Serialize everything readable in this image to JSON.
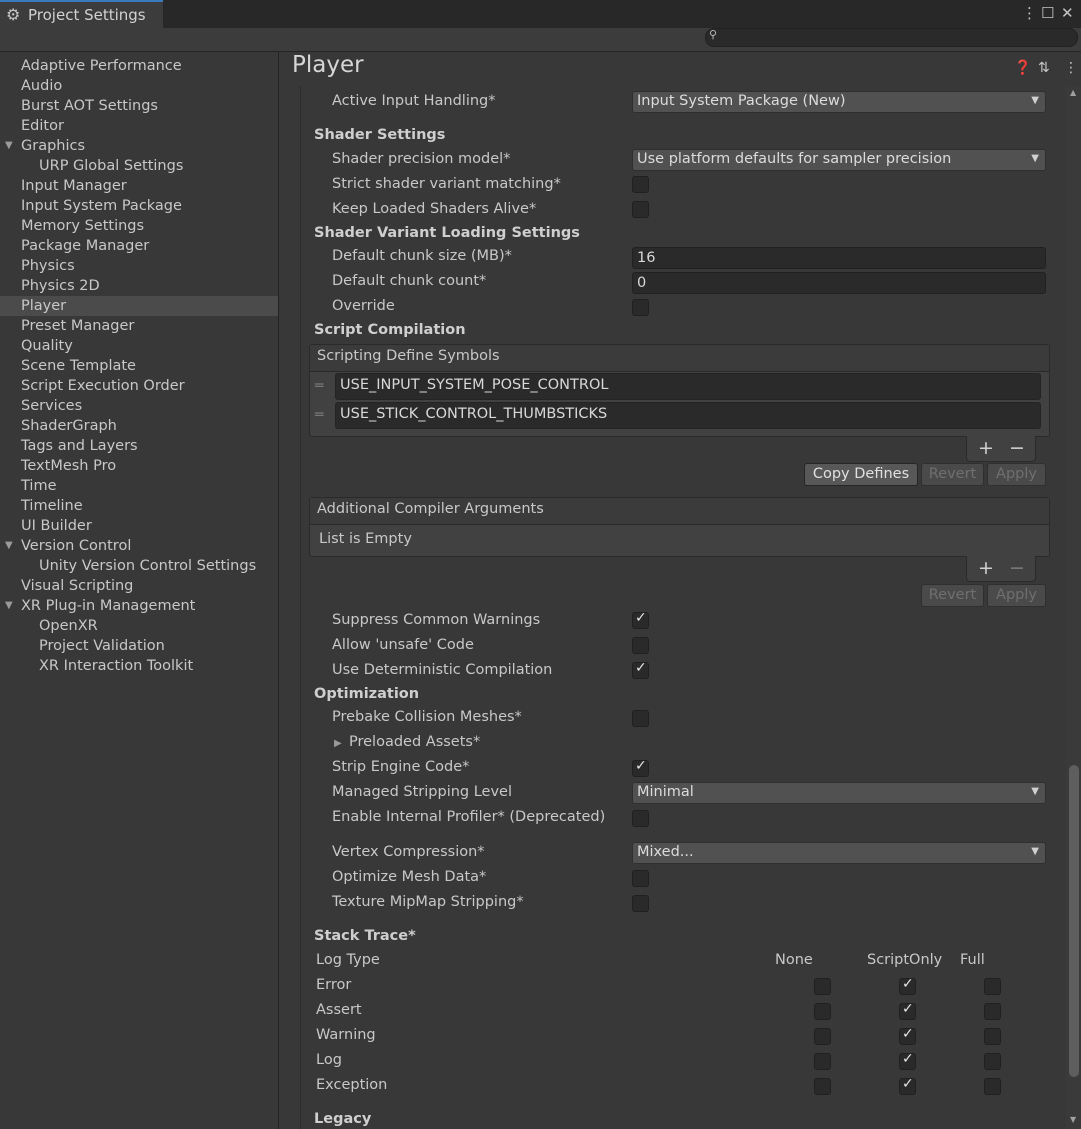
{
  "window": {
    "tab_title": "Project Settings",
    "search": {
      "placeholder": ""
    }
  },
  "sidebar": {
    "items": [
      {
        "label": "Adaptive Performance",
        "indent": 0,
        "foldout": "none",
        "selected": false
      },
      {
        "label": "Audio",
        "indent": 0,
        "foldout": "none",
        "selected": false
      },
      {
        "label": "Burst AOT Settings",
        "indent": 0,
        "foldout": "none",
        "selected": false
      },
      {
        "label": "Editor",
        "indent": 0,
        "foldout": "none",
        "selected": false
      },
      {
        "label": "Graphics",
        "indent": 0,
        "foldout": "open",
        "selected": false
      },
      {
        "label": "URP Global Settings",
        "indent": 1,
        "foldout": "none",
        "selected": false
      },
      {
        "label": "Input Manager",
        "indent": 0,
        "foldout": "none",
        "selected": false
      },
      {
        "label": "Input System Package",
        "indent": 0,
        "foldout": "none",
        "selected": false
      },
      {
        "label": "Memory Settings",
        "indent": 0,
        "foldout": "none",
        "selected": false
      },
      {
        "label": "Package Manager",
        "indent": 0,
        "foldout": "none",
        "selected": false
      },
      {
        "label": "Physics",
        "indent": 0,
        "foldout": "none",
        "selected": false
      },
      {
        "label": "Physics 2D",
        "indent": 0,
        "foldout": "none",
        "selected": false
      },
      {
        "label": "Player",
        "indent": 0,
        "foldout": "none",
        "selected": true
      },
      {
        "label": "Preset Manager",
        "indent": 0,
        "foldout": "none",
        "selected": false
      },
      {
        "label": "Quality",
        "indent": 0,
        "foldout": "none",
        "selected": false
      },
      {
        "label": "Scene Template",
        "indent": 0,
        "foldout": "none",
        "selected": false
      },
      {
        "label": "Script Execution Order",
        "indent": 0,
        "foldout": "none",
        "selected": false
      },
      {
        "label": "Services",
        "indent": 0,
        "foldout": "none",
        "selected": false
      },
      {
        "label": "ShaderGraph",
        "indent": 0,
        "foldout": "none",
        "selected": false
      },
      {
        "label": "Tags and Layers",
        "indent": 0,
        "foldout": "none",
        "selected": false
      },
      {
        "label": "TextMesh Pro",
        "indent": 0,
        "foldout": "none",
        "selected": false
      },
      {
        "label": "Time",
        "indent": 0,
        "foldout": "none",
        "selected": false
      },
      {
        "label": "Timeline",
        "indent": 0,
        "foldout": "none",
        "selected": false
      },
      {
        "label": "UI Builder",
        "indent": 0,
        "foldout": "none",
        "selected": false
      },
      {
        "label": "Version Control",
        "indent": 0,
        "foldout": "open",
        "selected": false
      },
      {
        "label": "Unity Version Control Settings",
        "indent": 1,
        "foldout": "none",
        "selected": false
      },
      {
        "label": "Visual Scripting",
        "indent": 0,
        "foldout": "none",
        "selected": false
      },
      {
        "label": "XR Plug-in Management",
        "indent": 0,
        "foldout": "open",
        "selected": false
      },
      {
        "label": "OpenXR",
        "indent": 1,
        "foldout": "none",
        "selected": false
      },
      {
        "label": "Project Validation",
        "indent": 1,
        "foldout": "none",
        "selected": false
      },
      {
        "label": "XR Interaction Toolkit",
        "indent": 1,
        "foldout": "none",
        "selected": false
      }
    ]
  },
  "main": {
    "title": "Player",
    "active_input_handling": {
      "label": "Active Input Handling*",
      "value": "Input System Package (New)"
    },
    "shader_settings": {
      "heading": "Shader Settings",
      "precision_model": {
        "label": "Shader precision model*",
        "value": "Use platform defaults for sampler precision"
      },
      "strict_variant": {
        "label": "Strict shader variant matching*",
        "checked": false
      },
      "keep_loaded": {
        "label": "Keep Loaded Shaders Alive*",
        "checked": false
      }
    },
    "variant_loading": {
      "heading": "Shader Variant Loading Settings",
      "chunk_size": {
        "label": "Default chunk size (MB)*",
        "value": "16"
      },
      "chunk_count": {
        "label": "Default chunk count*",
        "value": "0"
      },
      "override": {
        "label": "Override",
        "checked": false
      }
    },
    "script_compilation": {
      "heading": "Script Compilation",
      "define_symbols": {
        "header": "Scripting Define Symbols",
        "items": [
          "USE_INPUT_SYSTEM_POSE_CONTROL",
          "USE_STICK_CONTROL_THUMBSTICKS"
        ]
      },
      "plus": "+",
      "minus": "−",
      "copy_defines": "Copy Defines",
      "revert": "Revert",
      "apply": "Apply",
      "compiler_args": {
        "header": "Additional Compiler Arguments",
        "empty": "List is Empty"
      },
      "suppress_warnings": {
        "label": "Suppress Common Warnings",
        "checked": true
      },
      "allow_unsafe": {
        "label": "Allow 'unsafe' Code",
        "checked": false
      },
      "deterministic": {
        "label": "Use Deterministic Compilation",
        "checked": true
      }
    },
    "optimization": {
      "heading": "Optimization",
      "prebake": {
        "label": "Prebake Collision Meshes*",
        "checked": false
      },
      "preloaded": {
        "label": "Preloaded Assets*"
      },
      "strip_engine": {
        "label": "Strip Engine Code*",
        "checked": true
      },
      "managed_stripping": {
        "label": "Managed Stripping Level",
        "value": "Minimal"
      },
      "internal_profiler": {
        "label": "Enable Internal Profiler* (Deprecated)",
        "checked": false
      },
      "vertex_compression": {
        "label": "Vertex Compression*",
        "value": "Mixed..."
      },
      "optimize_mesh": {
        "label": "Optimize Mesh Data*",
        "checked": false
      },
      "mipmap_stripping": {
        "label": "Texture MipMap Stripping*",
        "checked": false
      }
    },
    "stack_trace": {
      "heading": "Stack Trace*",
      "columns": {
        "type": "Log Type",
        "none": "None",
        "script": "ScriptOnly",
        "full": "Full"
      },
      "rows": [
        {
          "label": "Error",
          "none": false,
          "script": true,
          "full": false
        },
        {
          "label": "Assert",
          "none": false,
          "script": true,
          "full": false
        },
        {
          "label": "Warning",
          "none": false,
          "script": true,
          "full": false
        },
        {
          "label": "Log",
          "none": false,
          "script": true,
          "full": false
        },
        {
          "label": "Exception",
          "none": false,
          "script": true,
          "full": false
        }
      ]
    },
    "legacy": {
      "heading": "Legacy"
    }
  }
}
